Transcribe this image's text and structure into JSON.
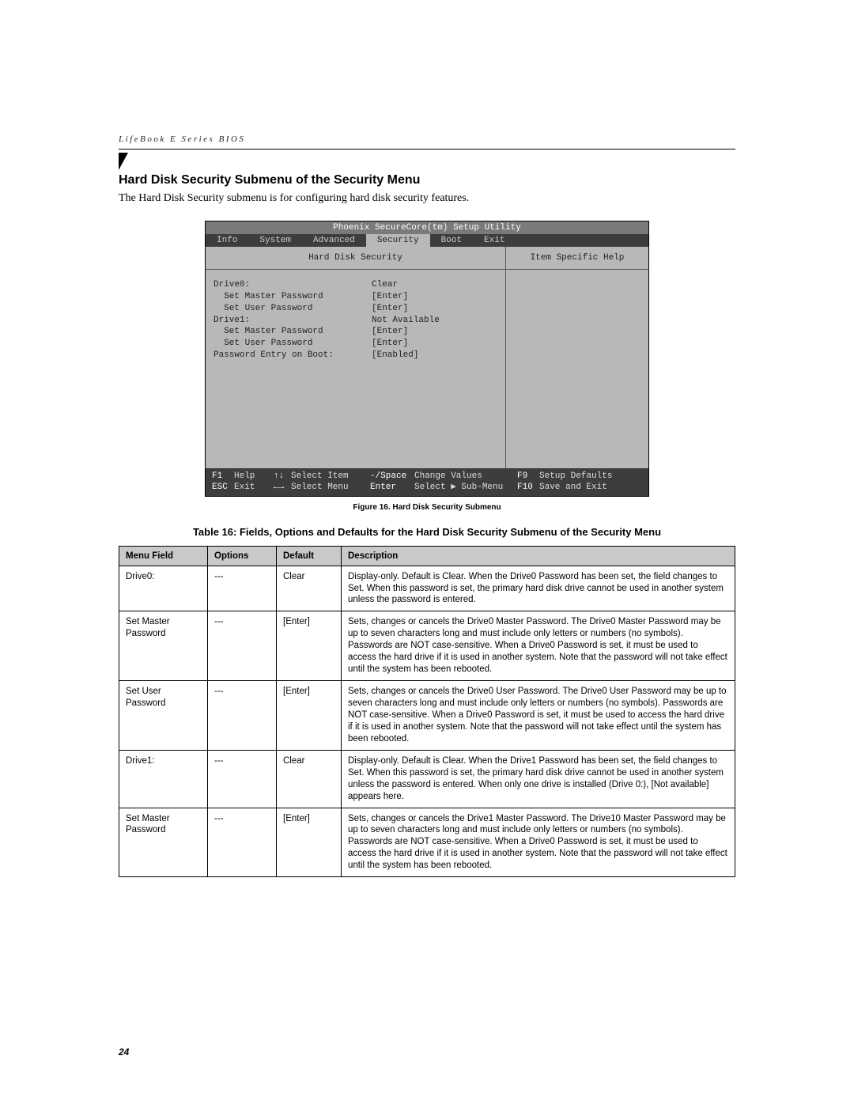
{
  "header": {
    "running_head": "LifeBook E Series BIOS"
  },
  "section": {
    "heading": "Hard Disk Security Submenu of the Security Menu",
    "intro": "The Hard Disk Security submenu is for configuring hard disk security features."
  },
  "bios": {
    "title": "Phoenix SecureCore(tm) Setup Utility",
    "tabs": [
      "Info",
      "System",
      "Advanced",
      "Security",
      "Boot",
      "Exit"
    ],
    "selected_tab": "Security",
    "left_header": "Hard Disk Security",
    "right_header": "Item Specific Help",
    "fields": [
      {
        "label": "Drive0:",
        "value": "Clear",
        "indent": 0
      },
      {
        "label": "Set Master Password",
        "value": "[Enter]",
        "indent": 1
      },
      {
        "label": "Set User Password",
        "value": "[Enter]",
        "indent": 1
      },
      {
        "label": "Drive1:",
        "value": "Not Available",
        "indent": 0
      },
      {
        "label": "Set Master Password",
        "value": "[Enter]",
        "indent": 1
      },
      {
        "label": "Set User Password",
        "value": "[Enter]",
        "indent": 1
      },
      {
        "label": "",
        "value": "",
        "indent": 0
      },
      {
        "label": "Password Entry on Boot:",
        "value": "[Enabled]",
        "indent": 0
      }
    ],
    "footer": {
      "row1": {
        "k1": "F1",
        "v1": "Help",
        "k2": "↑↓",
        "v2": "Select Item",
        "k3": "-/Space",
        "v3": "Change Values",
        "k4": "F9",
        "v4": "Setup Defaults"
      },
      "row2": {
        "k1": "ESC",
        "v1": "Exit",
        "k2": "←→",
        "v2": "Select Menu",
        "k3": "Enter",
        "v3": "Select ▶ Sub-Menu",
        "k4": "F10",
        "v4": "Save and Exit"
      }
    }
  },
  "caption": "Figure 16.  Hard Disk Security Submenu",
  "table_title": "Table 16: Fields, Options and Defaults for the Hard Disk Security Submenu of the Security Menu",
  "table": {
    "headers": [
      "Menu Field",
      "Options",
      "Default",
      "Description"
    ],
    "rows": [
      {
        "field": "Drive0:",
        "options": "---",
        "default": "Clear",
        "desc": "Display-only. Default is Clear. When the Drive0 Password has been set, the field changes to Set. When this password is set, the primary hard disk drive cannot be used in another system unless the password is entered."
      },
      {
        "field": "Set Master Password",
        "options": "---",
        "default": "[Enter]",
        "desc": "Sets, changes or cancels the Drive0 Master Password. The Drive0 Master Password may be up to seven characters long and must include only letters or numbers (no symbols). Passwords are NOT case-sensitive. When a Drive0 Password is set, it must be used to access the hard drive if it is used in another system. Note that the password will not take effect until the system has been rebooted."
      },
      {
        "field": "Set User Password",
        "options": "---",
        "default": "[Enter]",
        "desc": "Sets, changes or cancels the Drive0 User Password. The Drive0 User Password may be up to seven characters long and must include only letters or numbers (no symbols). Passwords are NOT case-sensitive. When a Drive0 Password is set, it must be used to access the hard drive if it is used in another system. Note that the password will not take effect until the system has been rebooted."
      },
      {
        "field": "Drive1:",
        "options": "---",
        "default": "Clear",
        "desc": "Display-only. Default is Clear. When the Drive1 Password has been set, the field changes to Set. When this password is set, the primary hard disk drive cannot be used in another system unless the password is entered. When only one drive is installed (Drive 0:), [Not available] appears here."
      },
      {
        "field": "Set Master Password",
        "options": "---",
        "default": "[Enter]",
        "desc": "Sets, changes or cancels the Drive1 Master Password. The Drive10 Master Password may be up to seven characters long and must include only letters or numbers (no symbols). Passwords are NOT case-sensitive. When a Drive0 Password is set, it must be used to access the hard drive if it is used in another system. Note that the password will not take effect until the system has been rebooted."
      }
    ]
  },
  "page_number": "24"
}
